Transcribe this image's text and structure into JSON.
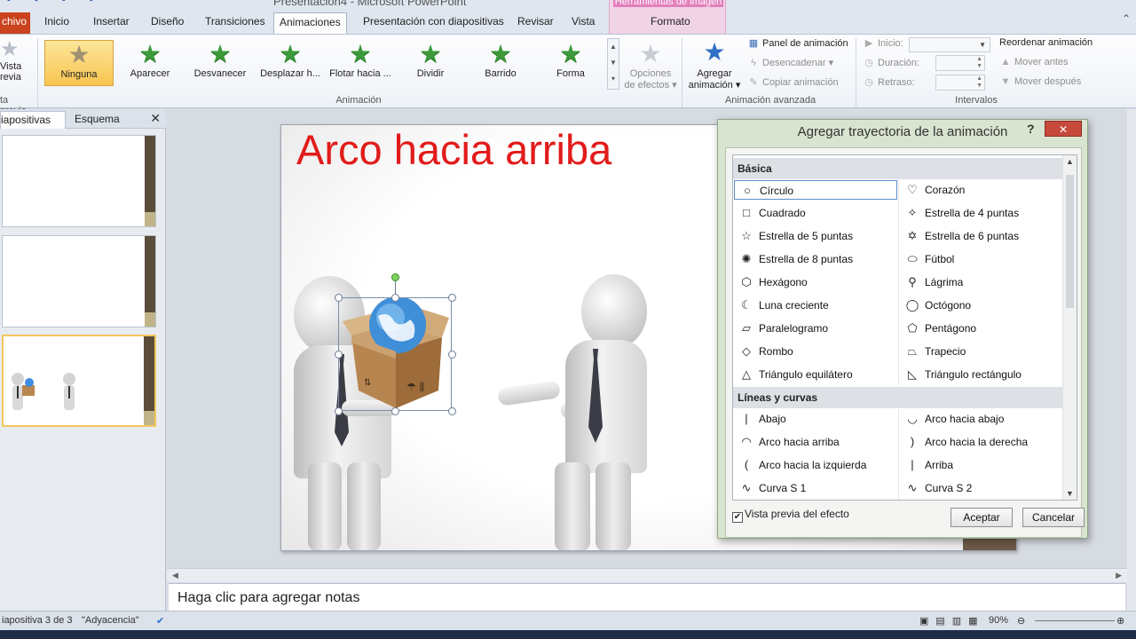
{
  "window": {
    "title": "Presentación4 - Microsoft PowerPoint",
    "context_tab_group": "Herramientas de imagen"
  },
  "tabs": [
    {
      "label": "chivo"
    },
    {
      "label": "Inicio"
    },
    {
      "label": "Insertar"
    },
    {
      "label": "Diseño"
    },
    {
      "label": "Transiciones"
    },
    {
      "label": "Animaciones"
    },
    {
      "label": "Presentación con diapositivas"
    },
    {
      "label": "Revisar"
    },
    {
      "label": "Vista"
    },
    {
      "label": "Formato"
    }
  ],
  "ribbon": {
    "preview": {
      "label1": "Vista",
      "label2": "revia",
      "group": "ta previa"
    },
    "animations": [
      {
        "label": "Ninguna",
        "selected": true
      },
      {
        "label": "Aparecer"
      },
      {
        "label": "Desvanecer"
      },
      {
        "label": "Desplazar h..."
      },
      {
        "label": "Flotar hacia ..."
      },
      {
        "label": "Dividir"
      },
      {
        "label": "Barrido"
      },
      {
        "label": "Forma"
      }
    ],
    "effect_options": {
      "line1": "Opciones",
      "line2": "de efectos"
    },
    "group_animation": "Animación",
    "add_animation": {
      "line1": "Agregar",
      "line2": "animación"
    },
    "panel": "Panel de animación",
    "trigger": "Desencadenar",
    "copy": "Copiar animación",
    "group_advanced": "Animación avanzada",
    "start": "Inicio:",
    "duration": "Duración:",
    "delay": "Retraso:",
    "reorder": "Reordenar animación",
    "move_earlier": "Mover antes",
    "move_later": "Mover después",
    "group_timing": "Intervalos"
  },
  "left_panel": {
    "tab_slides": "iapositivas",
    "tab_outline": "Esquema",
    "close": "✕"
  },
  "slide": {
    "title": "Arco hacia arriba"
  },
  "notes": {
    "placeholder": "Haga clic para agregar notas"
  },
  "status": {
    "slide_info": "iapositiva 3 de 3",
    "theme": "\"Adyacencia\"",
    "zoom": "90%"
  },
  "dialog": {
    "title": "Agregar trayectoria de la animación",
    "help": "?",
    "close": "✕",
    "cat_basic": "Básica",
    "basic_items": [
      {
        "label": "Círculo",
        "icon": "circle-icon",
        "glyph": "○"
      },
      {
        "label": "Corazón",
        "icon": "heart-icon",
        "glyph": "♡"
      },
      {
        "label": "Cuadrado",
        "icon": "square-icon",
        "glyph": "□"
      },
      {
        "label": "Estrella de 4 puntas",
        "icon": "star4-icon",
        "glyph": "✧"
      },
      {
        "label": "Estrella de 5 puntas",
        "icon": "star5-icon",
        "glyph": "☆"
      },
      {
        "label": "Estrella de 6 puntas",
        "icon": "star6-icon",
        "glyph": "✡"
      },
      {
        "label": "Estrella de 8 puntas",
        "icon": "star8-icon",
        "glyph": "✺"
      },
      {
        "label": "Fútbol",
        "icon": "football-icon",
        "glyph": "⬭"
      },
      {
        "label": "Hexágono",
        "icon": "hexagon-icon",
        "glyph": "⬡"
      },
      {
        "label": "Lágrima",
        "icon": "teardrop-icon",
        "glyph": "⚲"
      },
      {
        "label": "Luna creciente",
        "icon": "crescent-icon",
        "glyph": "☾"
      },
      {
        "label": "Octógono",
        "icon": "octagon-icon",
        "glyph": "◯"
      },
      {
        "label": "Paralelogramo",
        "icon": "parallelogram-icon",
        "glyph": "▱"
      },
      {
        "label": "Pentágono",
        "icon": "pentagon-icon",
        "glyph": "⬠"
      },
      {
        "label": "Rombo",
        "icon": "diamond-icon",
        "glyph": "◇"
      },
      {
        "label": "Trapecio",
        "icon": "trapezoid-icon",
        "glyph": "⏢"
      },
      {
        "label": "Triángulo equilátero",
        "icon": "triangle-icon",
        "glyph": "△"
      },
      {
        "label": "Triángulo rectángulo",
        "icon": "right-triangle-icon",
        "glyph": "◺"
      }
    ],
    "cat_lines": "Líneas y curvas",
    "line_items": [
      {
        "label": "Abajo",
        "icon": "down-line-icon",
        "glyph": "|"
      },
      {
        "label": "Arco hacia abajo",
        "icon": "arc-down-icon",
        "glyph": "◡"
      },
      {
        "label": "Arco hacia arriba",
        "icon": "arc-up-icon",
        "glyph": "◠"
      },
      {
        "label": "Arco hacia la derecha",
        "icon": "arc-right-icon",
        "glyph": ")"
      },
      {
        "label": "Arco hacia la izquierda",
        "icon": "arc-left-icon",
        "glyph": "("
      },
      {
        "label": "Arriba",
        "icon": "up-line-icon",
        "glyph": "|"
      },
      {
        "label": "Curva S 1",
        "icon": "s-curve-1-icon",
        "glyph": "∿"
      },
      {
        "label": "Curva S 2",
        "icon": "s-curve-2-icon",
        "glyph": "∿"
      }
    ],
    "preview_checkbox": "Vista previa del efecto",
    "preview_checked": true,
    "ok": "Aceptar",
    "cancel": "Cancelar"
  }
}
